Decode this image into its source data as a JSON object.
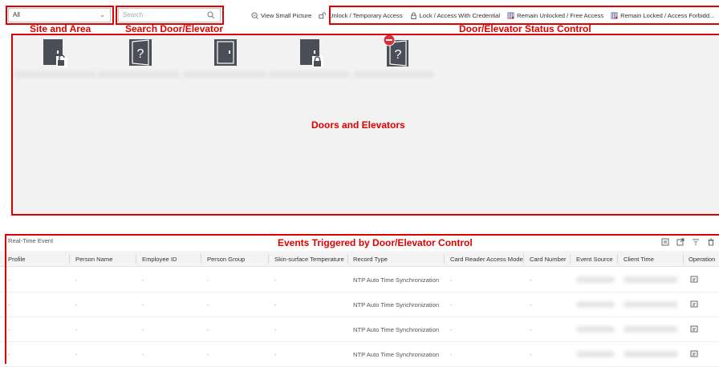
{
  "site_select": {
    "value": "All"
  },
  "search": {
    "placeholder": "Search"
  },
  "toolbar": {
    "view_small_picture": "View Small Picture",
    "unlock": "Unlock / Temporary Access",
    "lock": "Lock / Access With Credential",
    "remain_unlocked": "Remain Unlocked / Free Access",
    "remain_locked": "Remain Locked / Access Forbidd..."
  },
  "annotations": {
    "site_and_area": "Site and Area",
    "search_door": "Search Door/Elevator",
    "status_control": "Door/Elevator Status Control",
    "doors_and_elevators": "Doors and Elevators",
    "events_triggered": "Events Triggered by Door/Elevator Control"
  },
  "doors": [
    {
      "icon": "door-unlocked-icon",
      "glyph": ""
    },
    {
      "icon": "door-unknown-icon",
      "glyph": "?"
    },
    {
      "icon": "door-closed-icon",
      "glyph": ""
    },
    {
      "icon": "door-locked-icon",
      "glyph": ""
    },
    {
      "icon": "door-offline-unknown-icon",
      "glyph": "?"
    }
  ],
  "events": {
    "title": "Real-Time Event",
    "columns": [
      "Profile",
      "Person Name",
      "Employee ID",
      "Person Group",
      "Skin-surface Temperature",
      "Record Type",
      "Card Reader Access Mode",
      "Card Number",
      "Event Source",
      "Client Time",
      "Operation"
    ],
    "rows": [
      {
        "profile": "-",
        "person_name": "-",
        "employee_id": "-",
        "person_group": "-",
        "temperature": "-",
        "record_type": "NTP Auto Time Synchronization",
        "access_mode": "-",
        "card_number": "-"
      },
      {
        "profile": "-",
        "person_name": "-",
        "employee_id": "-",
        "person_group": "-",
        "temperature": "-",
        "record_type": "NTP Auto Time Synchronization",
        "access_mode": "-",
        "card_number": "-"
      },
      {
        "profile": "-",
        "person_name": "-",
        "employee_id": "-",
        "person_group": "-",
        "temperature": "-",
        "record_type": "NTP Auto Time Synchronization",
        "access_mode": "-",
        "card_number": "-"
      },
      {
        "profile": "-",
        "person_name": "-",
        "employee_id": "-",
        "person_group": "-",
        "temperature": "-",
        "record_type": "NTP Auto Time Synchronization",
        "access_mode": "-",
        "card_number": "-"
      }
    ]
  },
  "colors": {
    "annotation_red": "#e00000",
    "door_icon_dark": "#4a4f57",
    "accent_red": "#d9303a"
  }
}
